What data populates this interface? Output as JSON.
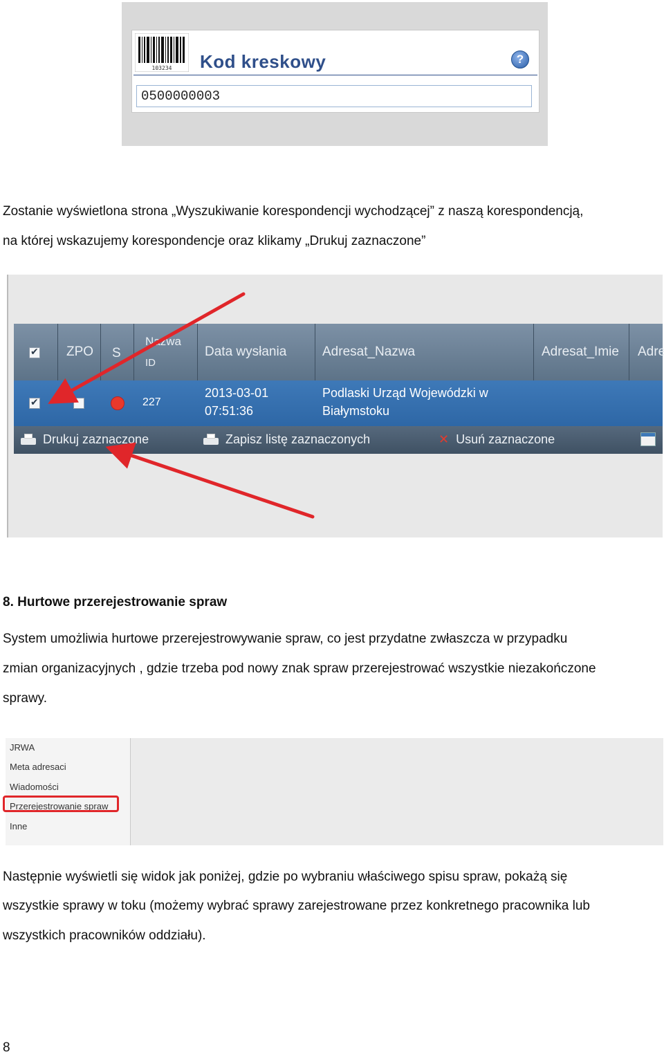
{
  "barcode_panel": {
    "title": "Kod kreskowy",
    "barcode_caption": "103234",
    "help_symbol": "?",
    "input_value": "0500000003"
  },
  "text": {
    "para1_line1": "Zostanie wyświetlona strona „Wyszukiwanie korespondencji wychodzącej” z naszą korespondencją,",
    "para1_line2": "na której wskazujemy korespondencje oraz klikamy „Drukuj zaznaczone”",
    "section_heading": "8.   Hurtowe przerejestrowanie spraw",
    "para2_line1": "System umożliwia hurtowe przerejestrowywanie spraw, co jest przydatne zwłaszcza w przypadku",
    "para2_line2": "zmian organizacyjnych , gdzie trzeba pod nowy znak spraw przerejestrować wszystkie niezakończone",
    "para2_line3": "sprawy.",
    "para3_line1": "Następnie wyświetli się widok jak poniżej, gdzie po wybraniu właściwego spisu spraw, pokażą się",
    "para3_line2": "wszystkie sprawy w toku (możemy wybrać sprawy zarejestrowane przez konkretnego pracownika lub",
    "para3_line3": "wszystkich pracowników oddziału).",
    "page_number": "8"
  },
  "grid": {
    "headers": {
      "zpo": "ZPO",
      "s": "S",
      "nazwa": "Nazwa",
      "id": "ID",
      "data": "Data wysłania",
      "adresat_nazwa": "Adresat_Nazwa",
      "adresat_imie": "Adresat_Imie",
      "adre": "Adre"
    },
    "row": {
      "id": "227",
      "date": "2013-03-01",
      "time": "07:51:36",
      "adresat_line1": "Podlaski Urząd Wojewódzki w",
      "adresat_line2": "Białymstoku"
    },
    "toolbar": {
      "print": "Drukuj zaznaczone",
      "save": "Zapisz listę zaznaczonych",
      "delete": "Usuń zaznaczone"
    },
    "colors": {
      "header": "#6b8097",
      "row": "#3572b1",
      "toolbar": "#4a5d70",
      "arrow": "#e0262a",
      "status_dot": "#e8392c"
    }
  },
  "menu": {
    "items": [
      "JRWA",
      "Meta adresaci",
      "Wiadomości",
      "Przerejestrowanie spraw",
      "Inne"
    ]
  }
}
